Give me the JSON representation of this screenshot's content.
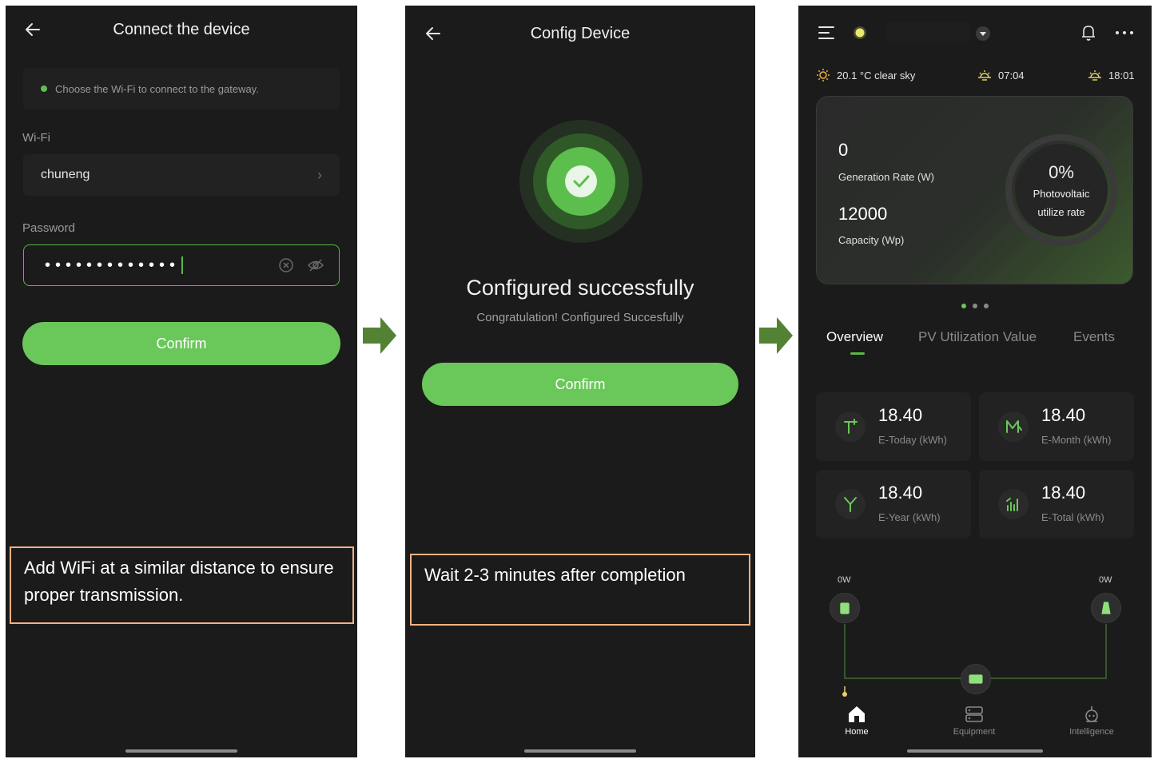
{
  "panel1": {
    "title": "Connect the device",
    "tip": "Choose the Wi-Fi to connect to the gateway.",
    "wifi_label": "Wi-Fi",
    "wifi_value": "chuneng",
    "password_label": "Password",
    "password_mask": "•••••••••••••",
    "confirm_label": "Confirm",
    "note": "Add WiFi at a similar distance to ensure proper transmission."
  },
  "panel2": {
    "title": "Config Device",
    "success_title": "Configured successfully",
    "success_subtitle": "Congratulation! Configured Succesfully",
    "confirm_label": "Confirm",
    "note": "Wait 2-3 minutes after completion"
  },
  "panel3": {
    "weather": "20.1 °C clear sky",
    "sunrise": "07:04",
    "sunset": "18:01",
    "generation_rate_value": "0",
    "generation_rate_label": "Generation Rate (W)",
    "capacity_value": "12000",
    "capacity_label": "Capacity (Wp)",
    "pv_percent": "0%",
    "pv_label_line1": "Photovoltaic",
    "pv_label_line2": "utilize rate",
    "pv_utilize_rate": 0,
    "tabs": [
      "Overview",
      "PV Utilization Value",
      "Events"
    ],
    "active_tab": "Overview",
    "stats": [
      {
        "value": "18.40",
        "label": "E-Today (kWh)",
        "icon": "today-icon"
      },
      {
        "value": "18.40",
        "label": "E-Month (kWh)",
        "icon": "month-icon"
      },
      {
        "value": "18.40",
        "label": "E-Year (kWh)",
        "icon": "year-icon"
      },
      {
        "value": "18.40",
        "label": "E-Total (kWh)",
        "icon": "total-icon"
      }
    ],
    "flow_left": "0W",
    "flow_right": "0W",
    "nav": [
      "Home",
      "Equipment",
      "Intelligence"
    ],
    "active_nav": "Home"
  },
  "colors": {
    "accent": "#6ac75a",
    "phone_bg": "#1b1b1b",
    "note_border": "#f4b183",
    "flow_arrow": "#548235"
  },
  "icons": [
    "back-arrow-icon",
    "checkmark-icon",
    "clear-icon",
    "eye-off-icon",
    "menu-icon",
    "sun-dot-icon",
    "dropdown-icon",
    "bell-icon",
    "more-icon",
    "sun-icon",
    "sunrise-icon",
    "sunset-icon",
    "home-icon",
    "equipment-icon",
    "intelligence-icon"
  ]
}
